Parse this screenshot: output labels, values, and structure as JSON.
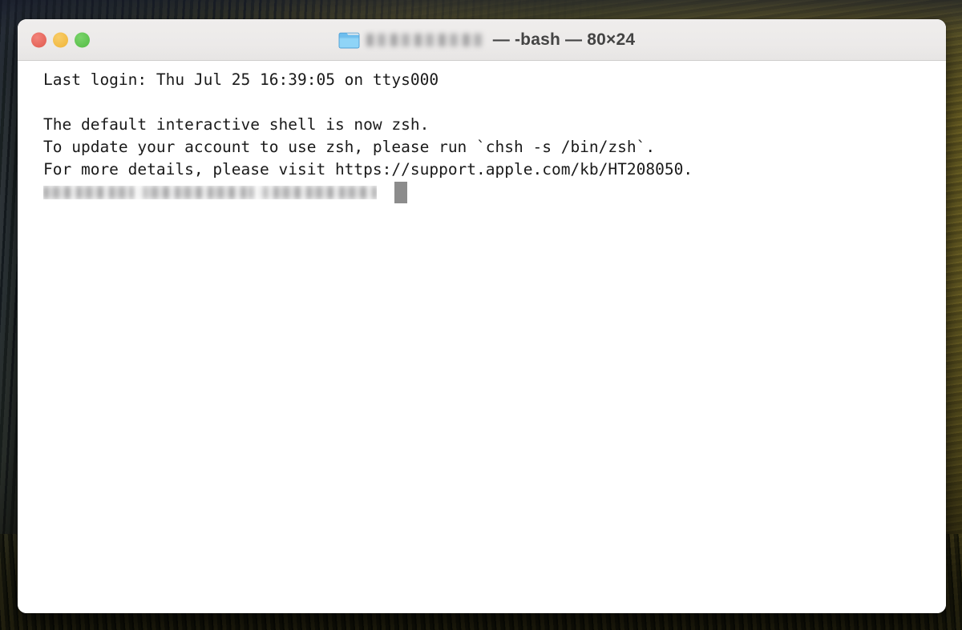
{
  "window": {
    "title_suffix": "— -bash — 80×24",
    "title_redacted_label": "redacted-username",
    "folder_icon": "folder-icon",
    "traffic_lights": [
      {
        "name": "close",
        "color": "#ED6A5E"
      },
      {
        "name": "minimize",
        "color": "#F2BB45"
      },
      {
        "name": "zoom",
        "color": "#5EC24F"
      }
    ],
    "titlebar_color": "#ECEAE9"
  },
  "terminal": {
    "background_color": "#FFFFFF",
    "text_color": "#1A1A1A",
    "cursor_color": "#8C8C8C",
    "lines": [
      "Last login: Thu Jul 25 16:39:05 on ttys000",
      "",
      "The default interactive shell is now zsh.",
      "To update your account to use zsh, please run `chsh -s /bin/zsh`.",
      "For more details, please visit https://support.apple.com/kb/HT208050."
    ],
    "prompt_line_redacted_label": "redacted-shell-prompt"
  },
  "desktop": {
    "wallpaper_name": "macos-forest-field-wallpaper"
  }
}
